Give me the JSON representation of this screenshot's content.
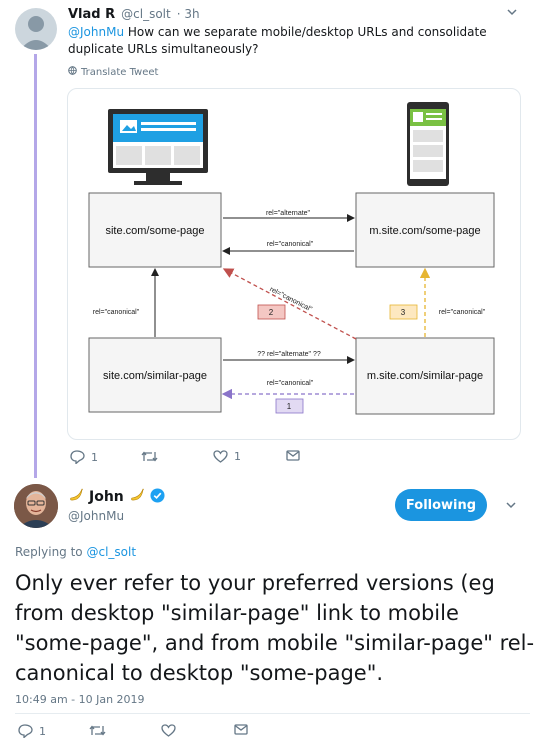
{
  "tweet1": {
    "name": "Vlad R",
    "handle": "@cl_solt",
    "time": "· 3h",
    "mention": "@JohnMu",
    "text": " How can we separate mobile/desktop URLs and consolidate duplicate URLs simultaneously?",
    "translate_label": "Translate Tweet",
    "reply_count": "1",
    "like_count": "1"
  },
  "diagram": {
    "node_desktop_some": "site.com/some-page",
    "node_mobile_some": "m.site.com/some-page",
    "node_desktop_similar": "site.com/similar-page",
    "node_mobile_similar": "m.site.com/similar-page",
    "edge_alternate_top": "rel=\"alternate\"",
    "edge_canonical_top": "rel=\"canonical\"",
    "edge_canonical_left": "rel=\"canonical\"",
    "edge_canonical_diag": "rel=\"canonical\"",
    "edge_canonical_right": "rel=\"canonical\"",
    "edge_alternate_bottom": "?? rel=\"alternate\" ??",
    "edge_canonical_bottom": "rel=\"canonical\"",
    "badge_1": "1",
    "badge_2": "2",
    "badge_3": "3",
    "colors": {
      "red": "#c0504d",
      "orange": "#e6b531",
      "purple": "#8a74c9",
      "node_bg": "#f5f5f5"
    }
  },
  "tweet2": {
    "name": "John",
    "handle": "@JohnMu",
    "follow_label": "Following",
    "replying_prefix": "Replying to ",
    "replying_handle": "@cl_solt",
    "text": "Only ever refer to your preferred versions (eg from desktop \"similar-page\" link to mobile \"some-page\", and from mobile \"similar-page\" rel-canonical to desktop \"some-page\".",
    "timestamp": "10:49 am - 10 Jan 2019",
    "reply_count": "1"
  },
  "icons": [
    "reply-icon",
    "retweet-icon",
    "like-icon",
    "message-icon",
    "globe-icon",
    "verified-icon",
    "banana-icon",
    "chevron-down-icon"
  ]
}
